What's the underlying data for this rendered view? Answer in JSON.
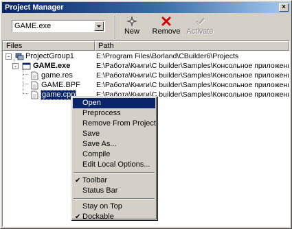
{
  "window": {
    "title": "Project Manager",
    "close_label": "×"
  },
  "toolbar": {
    "combo_value": "GAME.exe",
    "new_label": "New",
    "remove_label": "Remove",
    "activate_label": "Activate",
    "colors": {
      "new_icon": "#7a7a7a",
      "remove_icon": "#d00000"
    }
  },
  "columns": {
    "files": "Files",
    "path": "Path"
  },
  "tree": [
    {
      "name": "ProjectGroup1",
      "path": "E:\\Program Files\\Borland\\CBuilder6\\Projects",
      "icon": "project-group-icon",
      "expander": "-"
    },
    {
      "name": "GAME.exe",
      "path": "E:\\Работа\\Книги\\C builder\\Samples\\Консольное приложение",
      "icon": "exe-icon",
      "expander": "-"
    },
    {
      "name": "game.res",
      "path": "E:\\Работа\\Книги\\C builder\\Samples\\Консольное приложение",
      "icon": "file-icon"
    },
    {
      "name": "GAME.BPF",
      "path": "E:\\Работа\\Книги\\C builder\\Samples\\Консольное приложение",
      "icon": "file-icon"
    },
    {
      "name": "game.cpp",
      "path": "E:\\Работа\\Книги\\C builder\\Samples\\Консольное приложение",
      "icon": "file-icon"
    }
  ],
  "context_menu": {
    "items": [
      {
        "label": "Open",
        "highlighted": true
      },
      {
        "label": "Preprocess"
      },
      {
        "label": "Remove From Project"
      },
      {
        "label": "Save"
      },
      {
        "label": "Save As..."
      },
      {
        "label": "Compile"
      },
      {
        "label": "Edit Local Options..."
      },
      {
        "label": "Toolbar",
        "checked": true
      },
      {
        "label": "Status Bar"
      },
      {
        "label": "Stay on Top"
      },
      {
        "label": "Dockable",
        "checked": true
      }
    ],
    "check_glyph": "✔"
  }
}
